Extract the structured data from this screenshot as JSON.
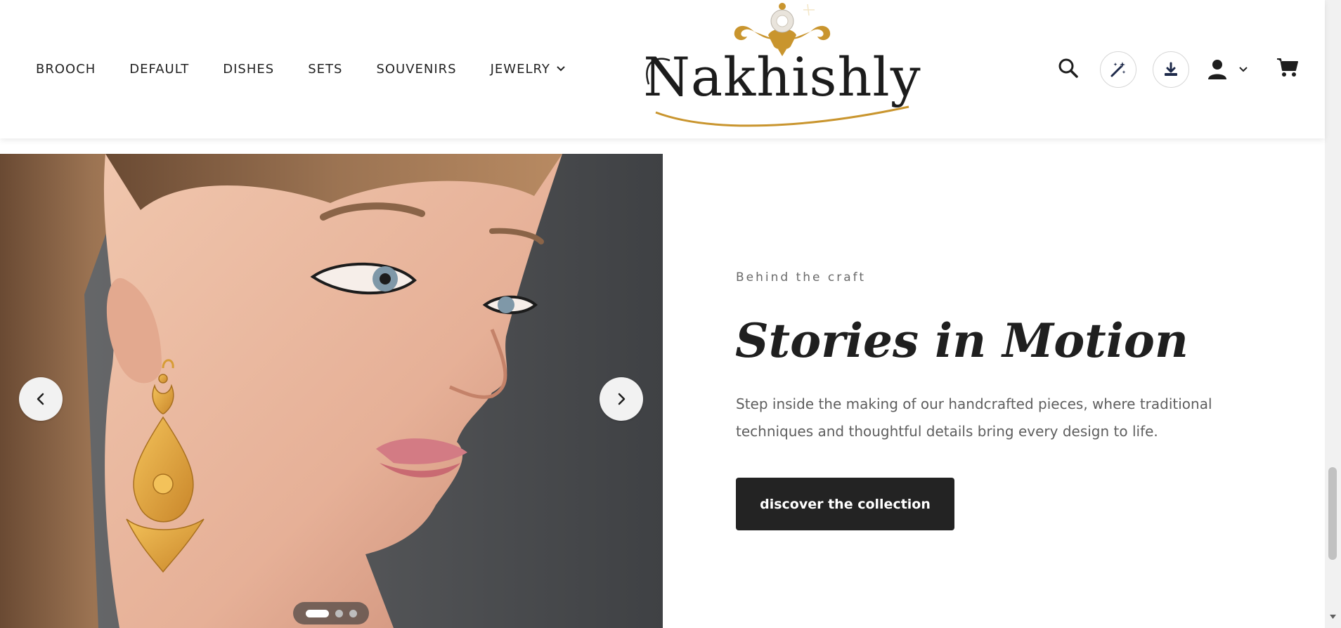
{
  "nav": {
    "items": [
      {
        "label": "BROOCH"
      },
      {
        "label": "DEFAULT"
      },
      {
        "label": "DISHES"
      },
      {
        "label": "SETS"
      },
      {
        "label": "SOUVENIRS"
      },
      {
        "label": "JEWELRY",
        "has_dropdown": true
      }
    ]
  },
  "logo": {
    "text": "Nakhishly"
  },
  "tools": {
    "icons": [
      "search-icon",
      "magic-wand-icon",
      "download-icon",
      "user-icon",
      "cart-icon"
    ]
  },
  "carousel": {
    "dots": {
      "count": 3,
      "active_index": 0
    },
    "prev_icon": "chevron-left-icon",
    "next_icon": "chevron-right-icon"
  },
  "feature": {
    "eyebrow": "Behind the craft",
    "title": "Stories in Motion",
    "description": "Step inside the making of our handcrafted pieces, where traditional techniques and thoughtful details bring every design to life.",
    "cta_label": "discover the collection"
  },
  "colors": {
    "accent_gold": "#c9952e",
    "button_dark": "#232323",
    "text_dark": "#1f1f1f"
  }
}
